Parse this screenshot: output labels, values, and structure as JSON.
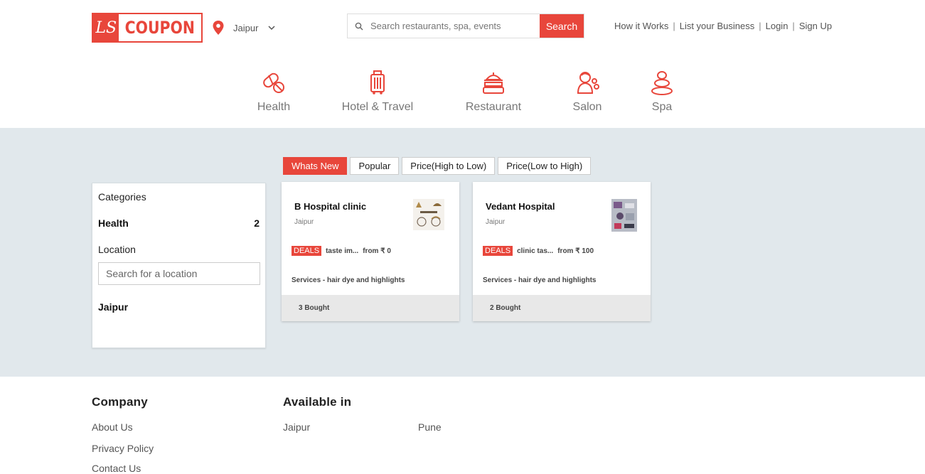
{
  "header": {
    "logo_mark": "LS",
    "logo_text": "COUPON",
    "city": "Jaipur",
    "search_placeholder": "Search restaurants, spa, events",
    "search_button": "Search",
    "nav": [
      "How it Works",
      "List your Business",
      "Login",
      "Sign Up"
    ]
  },
  "categories": [
    {
      "label": "Health",
      "icon": "health-icon"
    },
    {
      "label": "Hotel & Travel",
      "icon": "luggage-icon"
    },
    {
      "label": "Restaurant",
      "icon": "restaurant-icon"
    },
    {
      "label": "Salon",
      "icon": "salon-icon"
    },
    {
      "label": "Spa",
      "icon": "spa-stones-icon"
    }
  ],
  "sorts": [
    "Whats New",
    "Popular",
    "Price(High to Low)",
    "Price(Low to High)"
  ],
  "active_sort": "Whats New",
  "sidebar": {
    "categories_title": "Categories",
    "category": {
      "name": "Health",
      "count": "2"
    },
    "location_title": "Location",
    "location_placeholder": "Search for a location",
    "location_value": "Jaipur"
  },
  "cards": [
    {
      "name": "B Hospital clinic",
      "city": "Jaipur",
      "badge": "DEALS",
      "deal": "taste im...",
      "price": "from ₹ 0",
      "services": "Services - hair dye and highlights",
      "bought": "3 Bought"
    },
    {
      "name": "Vedant Hospital",
      "city": "Jaipur",
      "badge": "DEALS",
      "deal": "clinic tas...",
      "price": "from ₹ 100",
      "services": "Services - hair dye and highlights",
      "bought": "2 Bought"
    }
  ],
  "footer": {
    "company_title": "Company",
    "company_links": [
      "About Us",
      "Privacy Policy",
      "Contact Us"
    ],
    "available_title": "Available in",
    "cities": [
      "Jaipur",
      "Pune"
    ]
  },
  "colors": {
    "accent": "#e8463b",
    "main_bg": "#e1e8ec"
  }
}
